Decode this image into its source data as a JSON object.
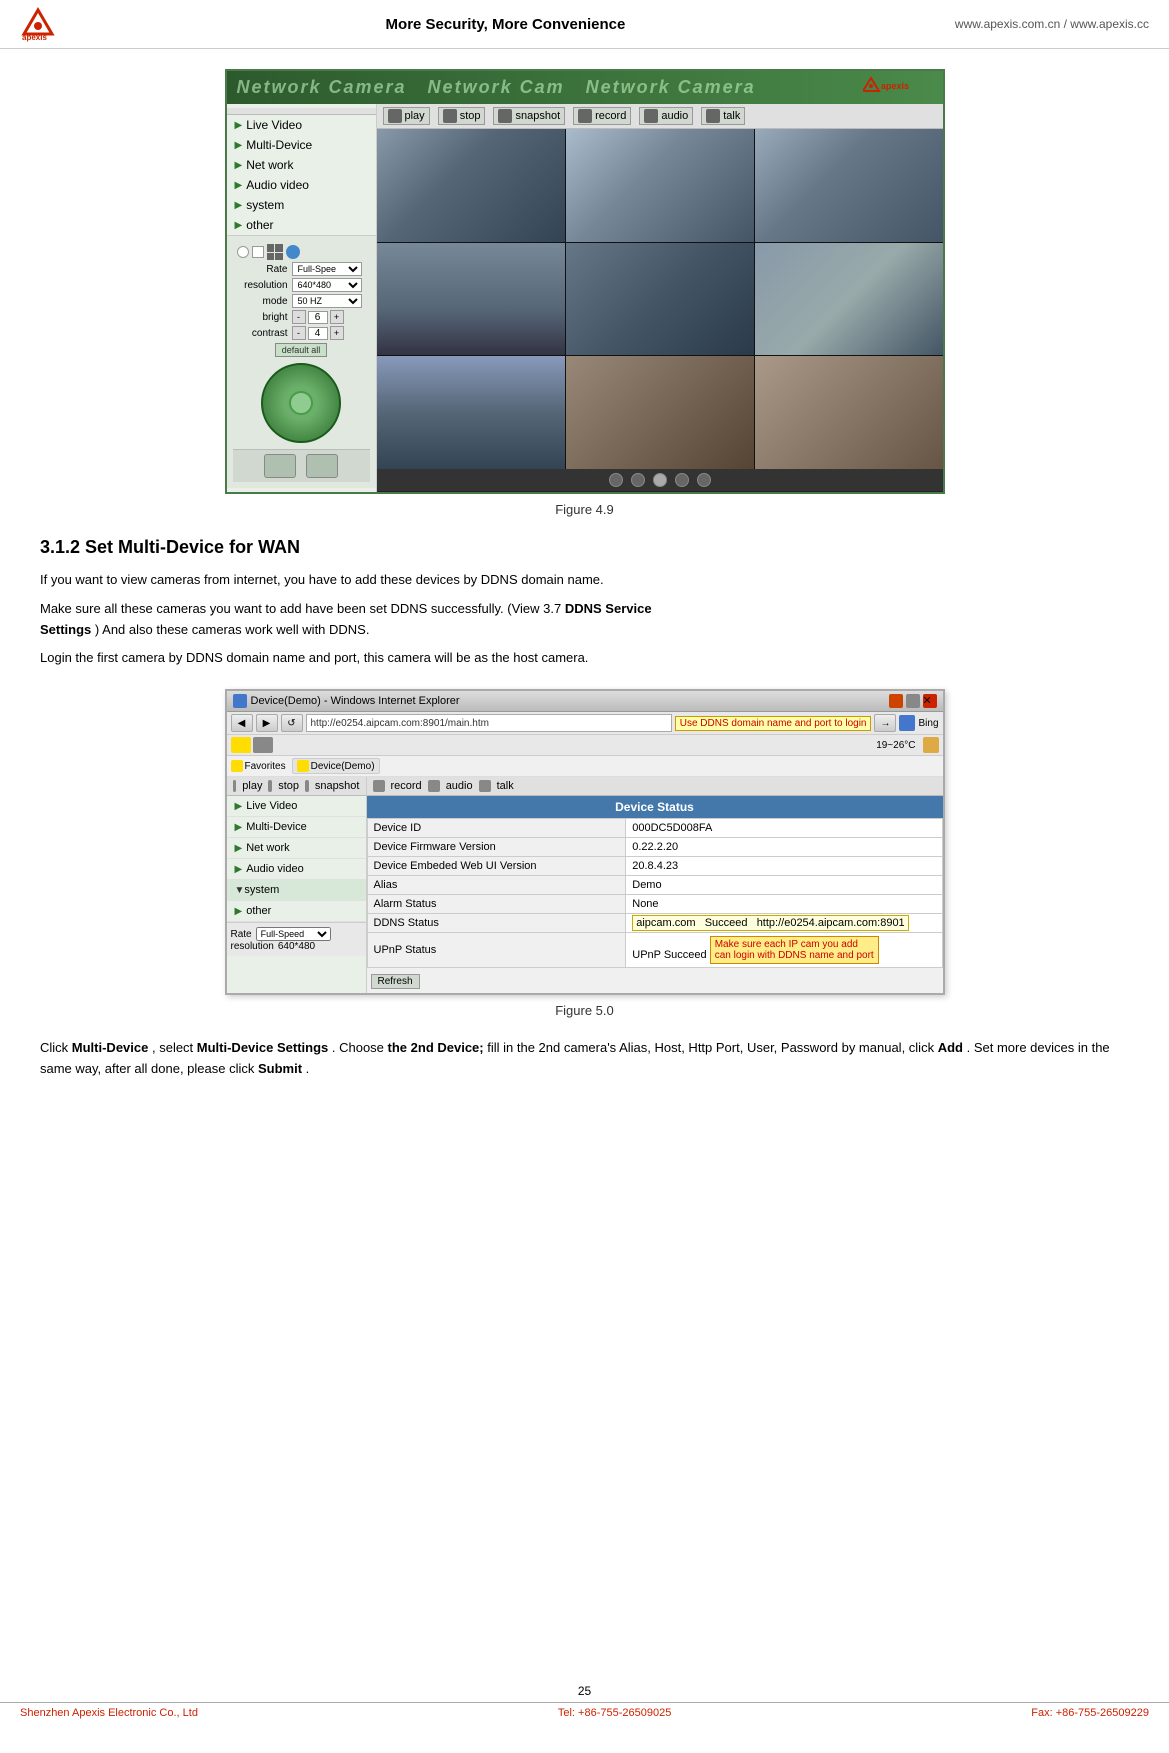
{
  "header": {
    "tagline": "More Security, More Convenience",
    "link1": "www.apexis.com.cn",
    "separator": "/",
    "link2": "www.apexis.cc"
  },
  "figure49": {
    "label": "Figure 4.9"
  },
  "section": {
    "heading": "3.1.2 Set Multi-Device for WAN"
  },
  "body_paragraphs": {
    "p1": "If you want to view cameras from internet, you have to add these devices by DDNS domain name.",
    "p2_start": "Make sure all these cameras you want to add have been set DDNS successfully. (View 3.7 ",
    "p2_bold1": "DDNS Service",
    "p2_bold2": "Settings",
    "p2_end": ") And also these cameras work well with DDNS.",
    "p3": "Login the first camera by DDNS domain name and port, this camera will be as the host camera."
  },
  "figure50": {
    "label": "Figure 5.0"
  },
  "caption": {
    "click_label": "Click ",
    "multi_device": "Multi-Device",
    "comma": ", select ",
    "multi_device_settings": "Multi-Device Settings",
    "choose": ". Choose ",
    "second_device": "the 2nd Device;",
    "fill_in": " fill in the 2nd camera's Alias, Host, Http Port, User, Password by manual, click ",
    "add": "Add",
    "set_more": ". Set more devices in the same way, after all done, please click ",
    "submit": "Submit",
    "period": "."
  },
  "camera_ui": {
    "nav_items": [
      "Live Video",
      "Multi-Device",
      "Net work",
      "Audio video",
      "system",
      "other"
    ],
    "toolbar_buttons": [
      "play",
      "stop",
      "snapshot",
      "record",
      "audio",
      "talk"
    ],
    "controls": {
      "rate_label": "Rate",
      "rate_value": "Full-Spee",
      "resolution_label": "resolution",
      "resolution_value": "640*480",
      "mode_label": "mode",
      "mode_value": "50 HZ",
      "bright_label": "bright",
      "bright_value": "6",
      "contrast_label": "contrast",
      "contrast_value": "4",
      "default_btn": "default all"
    }
  },
  "browser": {
    "title": "Device(Demo) - Windows Internet Explorer",
    "address": "http://e0254.aipcam.com:8901/main.htm",
    "ddns_annotation": "Use DDNS domain name and port to login",
    "search_text": "19~26°C",
    "search_engine": "Bing",
    "favorites_label": "Favorites",
    "device_demo_tab": "Device(Demo)",
    "nav_items": [
      "Live Video",
      "Multi-Device",
      "Net work",
      "Audio video",
      "system",
      "other"
    ],
    "device_status_title": "Device Status",
    "device_table_rows": [
      {
        "label": "Device ID",
        "value": "000DC5D008FA"
      },
      {
        "label": "Device Firmware Version",
        "value": "0.22.2.20"
      },
      {
        "label": "Device Embeded Web UI Version",
        "value": "20.8.4.23"
      },
      {
        "label": "Alias",
        "value": "Demo"
      },
      {
        "label": "Alarm Status",
        "value": "None"
      },
      {
        "label": "DDNS Status",
        "value": "aipcam.com  Succeed  http://e0254.aipcam.com:8901"
      },
      {
        "label": "UPnP Status",
        "value": "UPnP Succeed"
      }
    ],
    "refresh_btn": "Refresh",
    "upnp_annotation": "Make sure each IP cam you add\ncan login with DDNS name and port",
    "rate_label": "Rate",
    "rate_value": "Full-Speed",
    "resolution_label": "resolution",
    "resolution_value": "640*480"
  },
  "footer": {
    "page_number": "25",
    "company": "Shenzhen Apexis Electronic Co., Ltd",
    "tel_label": "Tel: +86-755-26509025",
    "fax_label": "Fax: +86-755-26509229"
  }
}
